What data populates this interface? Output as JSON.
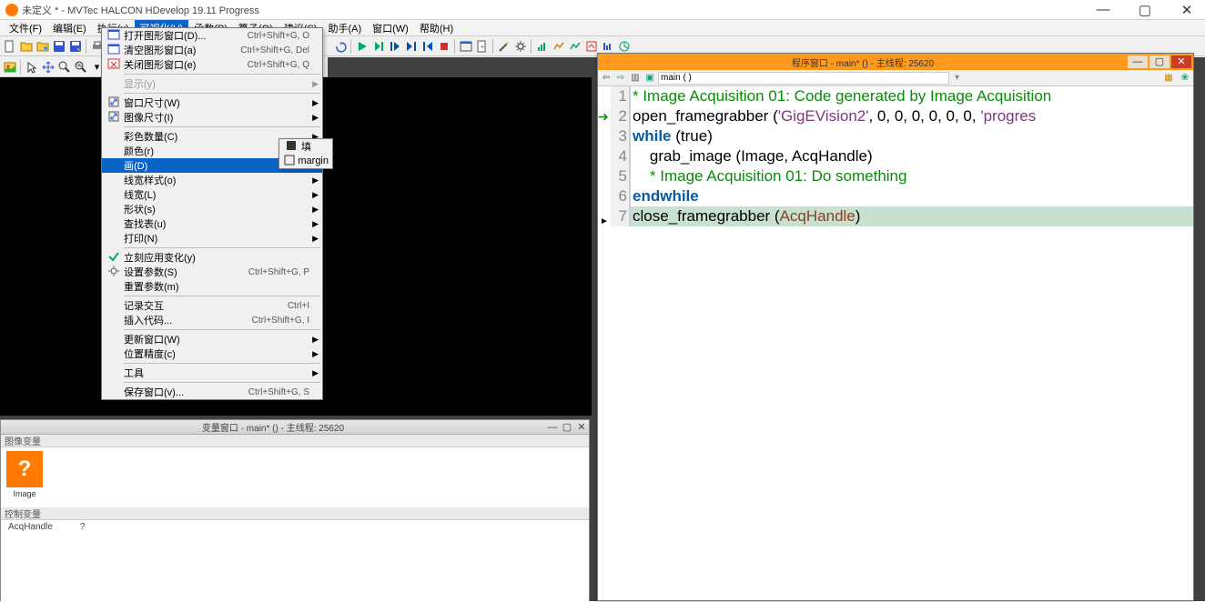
{
  "app": {
    "title": "未定义 * - MVTec HALCON HDevelop 19.11 Progress"
  },
  "menubar": [
    "文件(F)",
    "编辑(E)",
    "执行(x)",
    "可视化(V)",
    "函数(P)",
    "算子(O)",
    "建议(S)",
    "助手(A)",
    "窗口(W)",
    "帮助(H)"
  ],
  "menubar_active_index": 3,
  "dropdown": {
    "groups": [
      [
        {
          "icon": "window",
          "label": "打开图形窗口(D)...",
          "shortcut": "Ctrl+Shift+G, O"
        },
        {
          "icon": "window",
          "label": "清空图形窗口(a)",
          "shortcut": "Ctrl+Shift+G, Del"
        },
        {
          "icon": "close",
          "label": "关闭图形窗口(e)",
          "shortcut": "Ctrl+Shift+G, Q"
        }
      ],
      [
        {
          "icon": "",
          "label": "显示(y)",
          "shortcut": "",
          "arrow": true,
          "dim": true
        }
      ],
      [
        {
          "icon": "size",
          "label": "窗口尺寸(W)",
          "arrow": true
        },
        {
          "icon": "size",
          "label": "图像尺寸(I)",
          "arrow": true
        }
      ],
      [
        {
          "icon": "",
          "label": "彩色数量(C)",
          "arrow": true
        },
        {
          "icon": "",
          "label": "颜色(r)",
          "arrow": true
        },
        {
          "icon": "",
          "label": "画(D)",
          "arrow": true,
          "hover": true
        },
        {
          "icon": "",
          "label": "线宽样式(o)",
          "arrow": true
        },
        {
          "icon": "",
          "label": "线宽(L)",
          "arrow": true
        },
        {
          "icon": "",
          "label": "形状(s)",
          "arrow": true
        },
        {
          "icon": "",
          "label": "查找表(u)",
          "arrow": true
        },
        {
          "icon": "",
          "label": "打印(N)",
          "arrow": true
        }
      ],
      [
        {
          "icon": "check",
          "label": "立刻应用变化(y)"
        },
        {
          "icon": "gear",
          "label": "设置参数(S)",
          "shortcut": "Ctrl+Shift+G, P"
        },
        {
          "icon": "",
          "label": "重置参数(m)"
        }
      ],
      [
        {
          "icon": "",
          "label": "记录交互",
          "shortcut": "Ctrl+I"
        },
        {
          "icon": "",
          "label": "插入代码...",
          "shortcut": "Ctrl+Shift+G, I"
        }
      ],
      [
        {
          "icon": "",
          "label": "更新窗口(W)",
          "arrow": true
        },
        {
          "icon": "",
          "label": "位置精度(c)",
          "arrow": true
        }
      ],
      [
        {
          "icon": "",
          "label": "工具",
          "arrow": true
        }
      ],
      [
        {
          "icon": "",
          "label": "保存窗口(v)...",
          "shortcut": "Ctrl+Shift+G, S"
        }
      ]
    ]
  },
  "submenu": [
    {
      "icon": "fill",
      "label": "填"
    },
    {
      "icon": "margin",
      "label": "margin"
    }
  ],
  "var_window": {
    "title": "变量窗口 - main* () - 主线程: 25620",
    "section1": "图像变量",
    "thumb_label": "Image",
    "section2": "控制变量",
    "ctrl_name": "AcqHandle",
    "ctrl_val": "?"
  },
  "code_window": {
    "title": "程序窗口 - main* () - 主线程: 25620",
    "nav_value": "main ( )",
    "lines": [
      {
        "n": 1,
        "t": "comment",
        "text": "* Image Acquisition 01: Code generated by Image Acquisition"
      },
      {
        "n": 2,
        "t": "open",
        "parts": [
          "open_framegrabber",
          " ",
          "(",
          "'GigEVision2'",
          ", 0, 0, 0, 0, 0, 0, ",
          "'progres"
        ]
      },
      {
        "n": 3,
        "t": "while",
        "text_kw": "while",
        "text_rest": " (true)"
      },
      {
        "n": 4,
        "t": "grab",
        "indent": "    ",
        "call": "grab_image",
        "args": " (Image, AcqHandle)"
      },
      {
        "n": 5,
        "t": "comment",
        "indent": "    ",
        "text": "* Image Acquisition 01: Do something"
      },
      {
        "n": 6,
        "t": "endwhile",
        "text": "endwhile"
      },
      {
        "n": 7,
        "t": "close",
        "call": "close_framegrabber",
        "args": " (",
        "id": "AcqHandle",
        "close": ")"
      }
    ]
  }
}
